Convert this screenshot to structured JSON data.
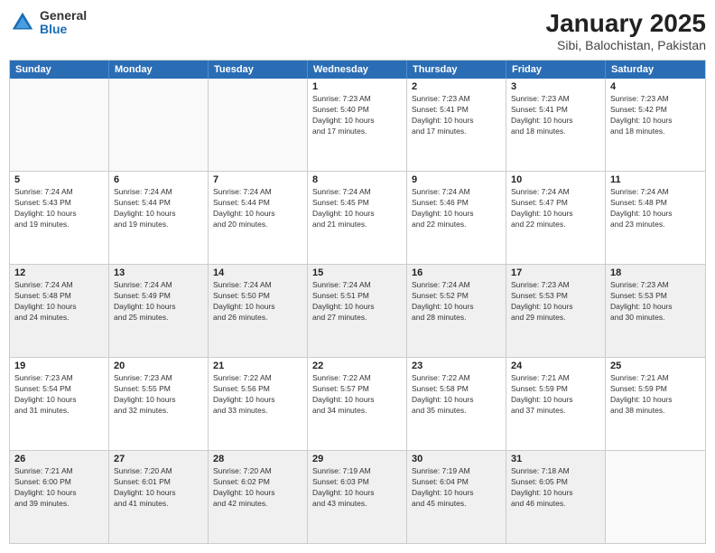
{
  "header": {
    "logo": {
      "general": "General",
      "blue": "Blue"
    },
    "title": "January 2025",
    "subtitle": "Sibi, Balochistan, Pakistan"
  },
  "weekdays": [
    "Sunday",
    "Monday",
    "Tuesday",
    "Wednesday",
    "Thursday",
    "Friday",
    "Saturday"
  ],
  "rows": [
    [
      {
        "day": "",
        "empty": true
      },
      {
        "day": "",
        "empty": true
      },
      {
        "day": "",
        "empty": true
      },
      {
        "day": "1",
        "info": "Sunrise: 7:23 AM\nSunset: 5:40 PM\nDaylight: 10 hours\nand 17 minutes."
      },
      {
        "day": "2",
        "info": "Sunrise: 7:23 AM\nSunset: 5:41 PM\nDaylight: 10 hours\nand 17 minutes."
      },
      {
        "day": "3",
        "info": "Sunrise: 7:23 AM\nSunset: 5:41 PM\nDaylight: 10 hours\nand 18 minutes."
      },
      {
        "day": "4",
        "info": "Sunrise: 7:23 AM\nSunset: 5:42 PM\nDaylight: 10 hours\nand 18 minutes."
      }
    ],
    [
      {
        "day": "5",
        "info": "Sunrise: 7:24 AM\nSunset: 5:43 PM\nDaylight: 10 hours\nand 19 minutes."
      },
      {
        "day": "6",
        "info": "Sunrise: 7:24 AM\nSunset: 5:44 PM\nDaylight: 10 hours\nand 19 minutes."
      },
      {
        "day": "7",
        "info": "Sunrise: 7:24 AM\nSunset: 5:44 PM\nDaylight: 10 hours\nand 20 minutes."
      },
      {
        "day": "8",
        "info": "Sunrise: 7:24 AM\nSunset: 5:45 PM\nDaylight: 10 hours\nand 21 minutes."
      },
      {
        "day": "9",
        "info": "Sunrise: 7:24 AM\nSunset: 5:46 PM\nDaylight: 10 hours\nand 22 minutes."
      },
      {
        "day": "10",
        "info": "Sunrise: 7:24 AM\nSunset: 5:47 PM\nDaylight: 10 hours\nand 22 minutes."
      },
      {
        "day": "11",
        "info": "Sunrise: 7:24 AM\nSunset: 5:48 PM\nDaylight: 10 hours\nand 23 minutes."
      }
    ],
    [
      {
        "day": "12",
        "info": "Sunrise: 7:24 AM\nSunset: 5:48 PM\nDaylight: 10 hours\nand 24 minutes.",
        "shaded": true
      },
      {
        "day": "13",
        "info": "Sunrise: 7:24 AM\nSunset: 5:49 PM\nDaylight: 10 hours\nand 25 minutes.",
        "shaded": true
      },
      {
        "day": "14",
        "info": "Sunrise: 7:24 AM\nSunset: 5:50 PM\nDaylight: 10 hours\nand 26 minutes.",
        "shaded": true
      },
      {
        "day": "15",
        "info": "Sunrise: 7:24 AM\nSunset: 5:51 PM\nDaylight: 10 hours\nand 27 minutes.",
        "shaded": true
      },
      {
        "day": "16",
        "info": "Sunrise: 7:24 AM\nSunset: 5:52 PM\nDaylight: 10 hours\nand 28 minutes.",
        "shaded": true
      },
      {
        "day": "17",
        "info": "Sunrise: 7:23 AM\nSunset: 5:53 PM\nDaylight: 10 hours\nand 29 minutes.",
        "shaded": true
      },
      {
        "day": "18",
        "info": "Sunrise: 7:23 AM\nSunset: 5:53 PM\nDaylight: 10 hours\nand 30 minutes.",
        "shaded": true
      }
    ],
    [
      {
        "day": "19",
        "info": "Sunrise: 7:23 AM\nSunset: 5:54 PM\nDaylight: 10 hours\nand 31 minutes."
      },
      {
        "day": "20",
        "info": "Sunrise: 7:23 AM\nSunset: 5:55 PM\nDaylight: 10 hours\nand 32 minutes."
      },
      {
        "day": "21",
        "info": "Sunrise: 7:22 AM\nSunset: 5:56 PM\nDaylight: 10 hours\nand 33 minutes."
      },
      {
        "day": "22",
        "info": "Sunrise: 7:22 AM\nSunset: 5:57 PM\nDaylight: 10 hours\nand 34 minutes."
      },
      {
        "day": "23",
        "info": "Sunrise: 7:22 AM\nSunset: 5:58 PM\nDaylight: 10 hours\nand 35 minutes."
      },
      {
        "day": "24",
        "info": "Sunrise: 7:21 AM\nSunset: 5:59 PM\nDaylight: 10 hours\nand 37 minutes."
      },
      {
        "day": "25",
        "info": "Sunrise: 7:21 AM\nSunset: 5:59 PM\nDaylight: 10 hours\nand 38 minutes."
      }
    ],
    [
      {
        "day": "26",
        "info": "Sunrise: 7:21 AM\nSunset: 6:00 PM\nDaylight: 10 hours\nand 39 minutes.",
        "shaded": true
      },
      {
        "day": "27",
        "info": "Sunrise: 7:20 AM\nSunset: 6:01 PM\nDaylight: 10 hours\nand 41 minutes.",
        "shaded": true
      },
      {
        "day": "28",
        "info": "Sunrise: 7:20 AM\nSunset: 6:02 PM\nDaylight: 10 hours\nand 42 minutes.",
        "shaded": true
      },
      {
        "day": "29",
        "info": "Sunrise: 7:19 AM\nSunset: 6:03 PM\nDaylight: 10 hours\nand 43 minutes.",
        "shaded": true
      },
      {
        "day": "30",
        "info": "Sunrise: 7:19 AM\nSunset: 6:04 PM\nDaylight: 10 hours\nand 45 minutes.",
        "shaded": true
      },
      {
        "day": "31",
        "info": "Sunrise: 7:18 AM\nSunset: 6:05 PM\nDaylight: 10 hours\nand 46 minutes.",
        "shaded": true
      },
      {
        "day": "",
        "empty": true,
        "shaded": true
      }
    ]
  ]
}
